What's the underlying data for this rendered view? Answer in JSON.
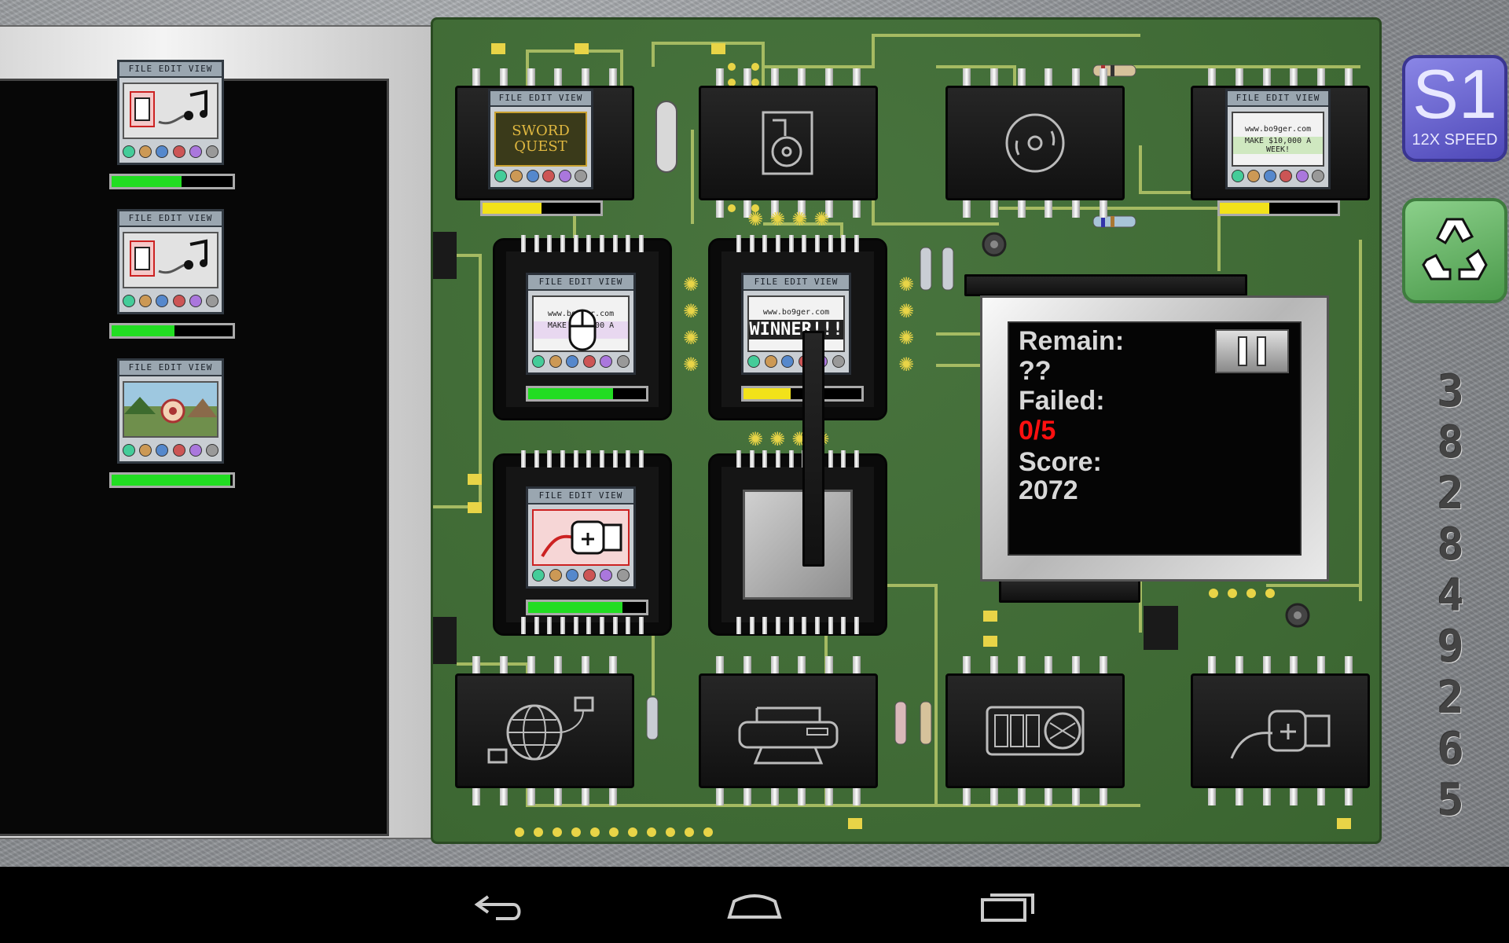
{
  "queue": {
    "items": [
      {
        "menu": "FILE EDIT VIEW",
        "type": "music",
        "progress": 0.58,
        "bar_color": "#22dd22"
      },
      {
        "menu": "FILE EDIT VIEW",
        "type": "music",
        "progress": 0.52,
        "bar_color": "#22dd22"
      },
      {
        "menu": "FILE EDIT VIEW",
        "type": "game-image",
        "progress": 0.98,
        "bar_color": "#22dd22"
      }
    ]
  },
  "board": {
    "sockets": [
      {
        "id": "top-left",
        "menu": "FILE EDIT VIEW",
        "text_line1": "SWORD",
        "text_line2": "QUEST",
        "progress": 0.5,
        "bar_color": "#f2e21a"
      },
      {
        "id": "top-right",
        "menu": "FILE EDIT VIEW",
        "text_line1": "www.bo9ger.com",
        "text_line2": "MAKE $10,000 A WEEK!",
        "progress": 0.42,
        "bar_color": "#f2e21a"
      },
      {
        "id": "center-a",
        "menu": "FILE EDIT VIEW",
        "text_line1": "www.bo9ger.com",
        "text_line2": "MAKE $10,000 A WEEK!",
        "progress": 0.72,
        "bar_color": "#22dd22"
      },
      {
        "id": "center-b",
        "menu": "FILE EDIT VIEW",
        "text_line1": "www.bo9ger.com",
        "text_line2": "WINNER!!!",
        "progress": 0.4,
        "bar_color": "#f2e21a"
      },
      {
        "id": "center-c",
        "menu": "FILE EDIT VIEW",
        "text_line1": "",
        "text_line2": "",
        "progress": 0.8,
        "bar_color": "#22dd22"
      }
    ],
    "devices": [
      "hard-drive-icon",
      "cd-icon",
      "network-globe-icon",
      "printer-icon",
      "graphics-card-icon",
      "usb-icon"
    ]
  },
  "status": {
    "remain_label": "Remain:",
    "remain_value": "??",
    "failed_label": "Failed:",
    "failed_value": "0/5",
    "failed_color": "#ff1010",
    "score_label": "Score:",
    "score_value": "2072"
  },
  "controls": {
    "speed_level": "S1",
    "speed_label": "12X SPEED"
  },
  "digit_column": [
    "3",
    "8",
    "2",
    "8",
    "4",
    "9",
    "2",
    "6",
    "5"
  ]
}
